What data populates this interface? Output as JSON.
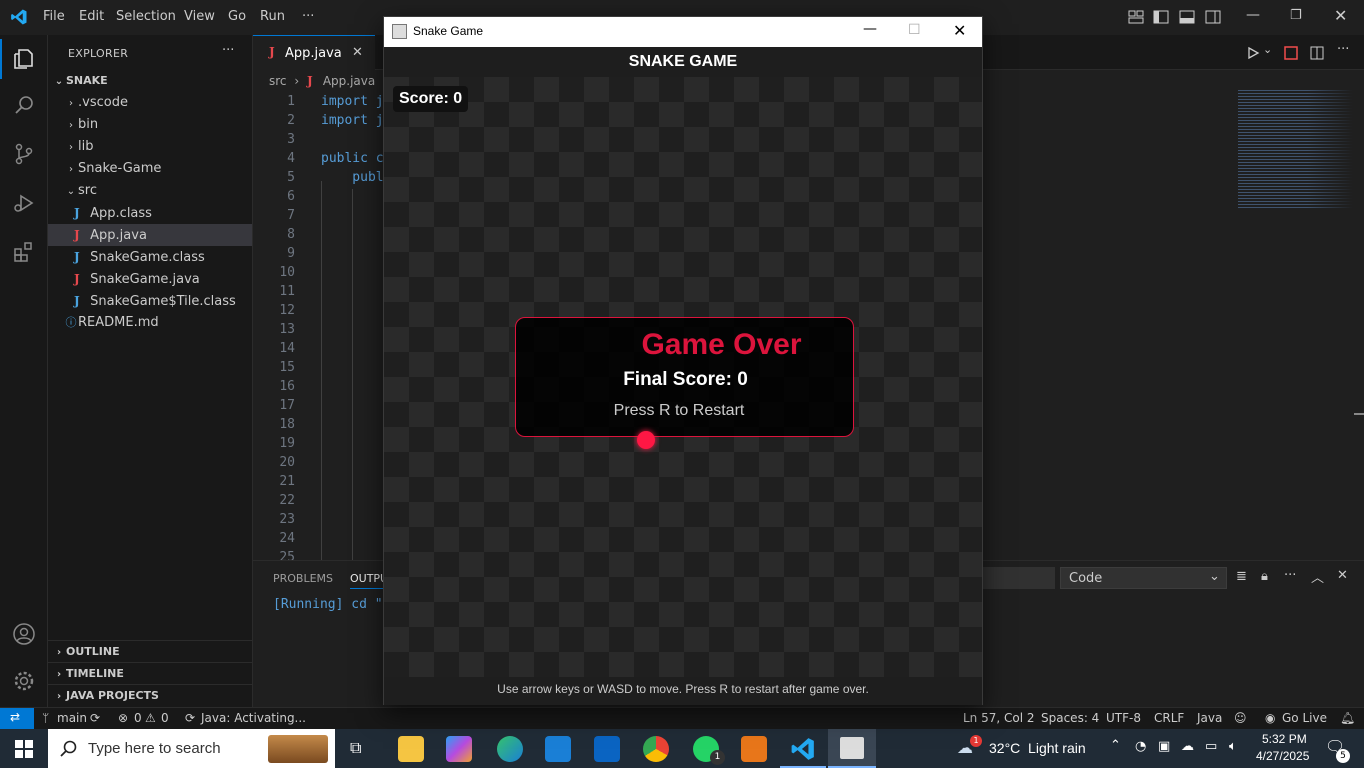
{
  "menu": [
    "File",
    "Edit",
    "Selection",
    "View",
    "Go",
    "Run",
    "···"
  ],
  "explorer": {
    "title": "EXPLORER",
    "more": "···",
    "root": "SNAKE",
    "items": [
      {
        "label": ".vscode",
        "type": "folder"
      },
      {
        "label": "bin",
        "type": "folder"
      },
      {
        "label": "lib",
        "type": "folder"
      },
      {
        "label": "Snake-Game",
        "type": "folder"
      },
      {
        "label": "src",
        "type": "folder-open"
      },
      {
        "label": "App.class",
        "type": "class"
      },
      {
        "label": "App.java",
        "type": "java",
        "selected": true
      },
      {
        "label": "SnakeGame.class",
        "type": "class"
      },
      {
        "label": "SnakeGame.java",
        "type": "java"
      },
      {
        "label": "SnakeGame$Tile.class",
        "type": "class"
      },
      {
        "label": "README.md",
        "type": "info"
      }
    ],
    "sections": [
      "OUTLINE",
      "TIMELINE",
      "JAVA PROJECTS"
    ]
  },
  "editor": {
    "tab": "App.java",
    "breadcrumb": [
      "src",
      "App.java"
    ],
    "line_numbers": [
      "1",
      "2",
      "3",
      "4",
      "5",
      "6",
      "7",
      "8",
      "9",
      "10",
      "11",
      "12",
      "13",
      "14",
      "15",
      "16",
      "17",
      "18",
      "19",
      "20",
      "21",
      "22",
      "23",
      "24",
      "25"
    ],
    "code_lines": [
      "import j",
      "import j",
      "",
      "public c",
      "    publ"
    ]
  },
  "panel": {
    "tabs": [
      "PROBLEMS",
      "OUTPU"
    ],
    "output_text": "[Running] cd \"",
    "dropdown_value": "Code"
  },
  "statusbar": {
    "branch": "main",
    "errors": "0",
    "warnings": "0",
    "java_status": "Java: Activating...",
    "position": "Ln 57, Col 2",
    "spaces": "Spaces: 4",
    "encoding": "UTF-8",
    "eol": "CRLF",
    "language": "Java",
    "golive": "Go Live"
  },
  "game": {
    "window_title": "Snake Game",
    "header": "SNAKE GAME",
    "score_label": "Score: 0",
    "game_over": "Game Over",
    "final_score": "Final Score: 0",
    "restart_hint": "Press R to Restart",
    "footer": "Use arrow keys or WASD to move. Press R to restart after game over."
  },
  "taskbar": {
    "search_placeholder": "Type here to search",
    "weather": "32°C  Light rain",
    "time": "5:32 PM",
    "date": "4/27/2025",
    "notif_count": "5",
    "whatsapp_badge": "1",
    "weather_badge": "1"
  },
  "colors": {
    "accent": "#0078d4",
    "game_over_red": "#dc143c",
    "food": "#ff1744",
    "java_icon": "#e5484d",
    "class_icon": "#4aa3df"
  }
}
